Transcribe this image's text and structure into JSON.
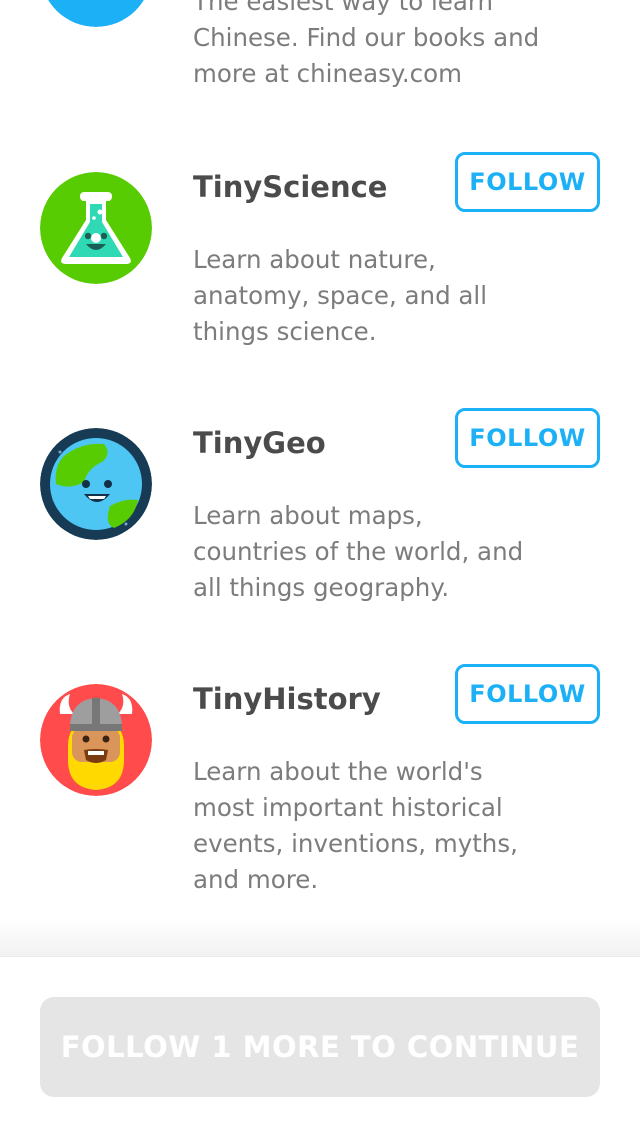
{
  "channels": [
    {
      "title": "",
      "desc_lines": [
        "The easiest way to learn",
        "Chinese. Find our books and",
        "more at chineasy.com"
      ],
      "follow_label": "",
      "icon": "chineasy-icon",
      "icon_color": "#1cb0f6"
    },
    {
      "title": "TinyScience",
      "desc_lines": [
        "Learn about nature,",
        "anatomy, space, and all",
        "things science."
      ],
      "follow_label": "FOLLOW",
      "icon": "flask-icon",
      "icon_color": "#58cc02"
    },
    {
      "title": "TinyGeo",
      "desc_lines": [
        "Learn about maps,",
        "countries of the world, and",
        "all things geography."
      ],
      "follow_label": "FOLLOW",
      "icon": "globe-icon",
      "icon_color": "#173b55"
    },
    {
      "title": "TinyHistory",
      "desc_lines": [
        "Learn about the world's",
        "most important historical",
        "events, inventions, myths,",
        "and more."
      ],
      "follow_label": "FOLLOW",
      "icon": "viking-icon",
      "icon_color": "#ff4b4b"
    }
  ],
  "footer": {
    "continue_label": "FOLLOW 1 MORE TO CONTINUE"
  },
  "colors": {
    "accent": "#1cb0f6",
    "disabled_button": "#e5e5e5",
    "title": "#4b4b4b",
    "description": "#7c7c7c"
  }
}
